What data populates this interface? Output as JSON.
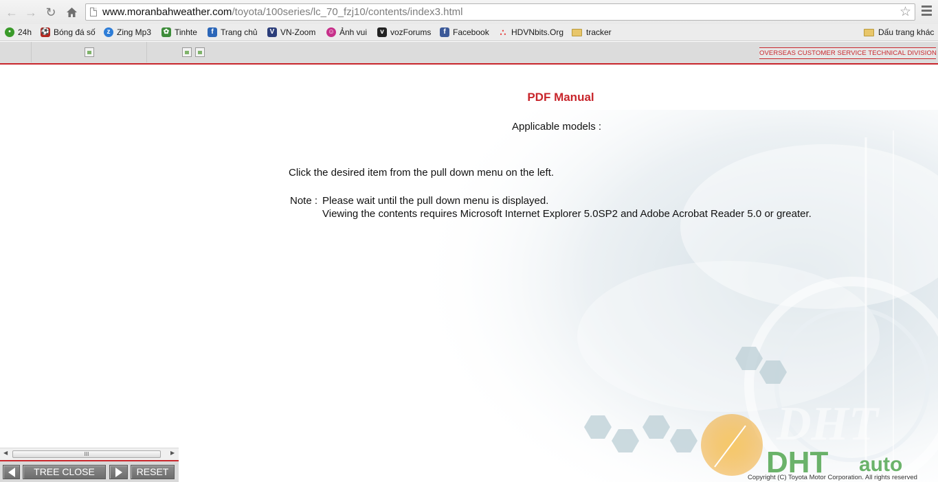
{
  "browser": {
    "url_host": "www.moranbahweather.com",
    "url_path": "/toyota/100series/lc_70_fzj10/contents/index3.html",
    "bookmarks": [
      {
        "label": "24h",
        "icon": "clock-icon",
        "color": "#3a9a2a"
      },
      {
        "label": "Bóng đá số",
        "icon": "ball-icon",
        "color": "#b3261e"
      },
      {
        "label": "Zing Mp3",
        "icon": "zing-icon",
        "color": "#2e7dd7"
      },
      {
        "label": "Tinhte",
        "icon": "leaf-icon",
        "color": "#3d8c3a"
      },
      {
        "label": "Trang chủ",
        "icon": "home-logo-icon",
        "color": "#2b66b8"
      },
      {
        "label": "VN-Zoom",
        "icon": "vnzoom-icon",
        "color": "#2c3e7a"
      },
      {
        "label": "Ảnh vui",
        "icon": "smiley-icon",
        "color": "#c7308a"
      },
      {
        "label": "vozForums",
        "icon": "voz-icon",
        "color": "#222222"
      },
      {
        "label": "Facebook",
        "icon": "facebook-icon",
        "color": "#3b5998"
      },
      {
        "label": "HDVNbits.Org",
        "icon": "dots-icon",
        "color": "#e53935"
      },
      {
        "label": "tracker",
        "icon": "folder-icon",
        "color": "#e8c66a"
      }
    ],
    "other_bookmarks": "Dấu trang khác"
  },
  "header": {
    "division": "OVERSEAS CUSTOMER SERVICE TECHNICAL DIVISION"
  },
  "content": {
    "title": "PDF Manual",
    "models_label": "Applicable models :",
    "instruction": "Click the desired item from the pull down menu on the left.",
    "note_label": "Note :",
    "note_line1": "Please wait until the pull down menu is displayed.",
    "note_line2": "Viewing the contents requires Microsoft Internet Explorer 5.0SP2 and Adobe Acrobat Reader 5.0 or greater."
  },
  "controls": {
    "tree_close": "TREE CLOSE",
    "reset": "RESET",
    "scroll_grip": "III"
  },
  "footer": {
    "copyright": "Copyright (C) Toyota Motor Corporation. All rights reserved"
  },
  "colors": {
    "accent_red": "#c8252b",
    "header_gray": "#dcdcdc"
  }
}
